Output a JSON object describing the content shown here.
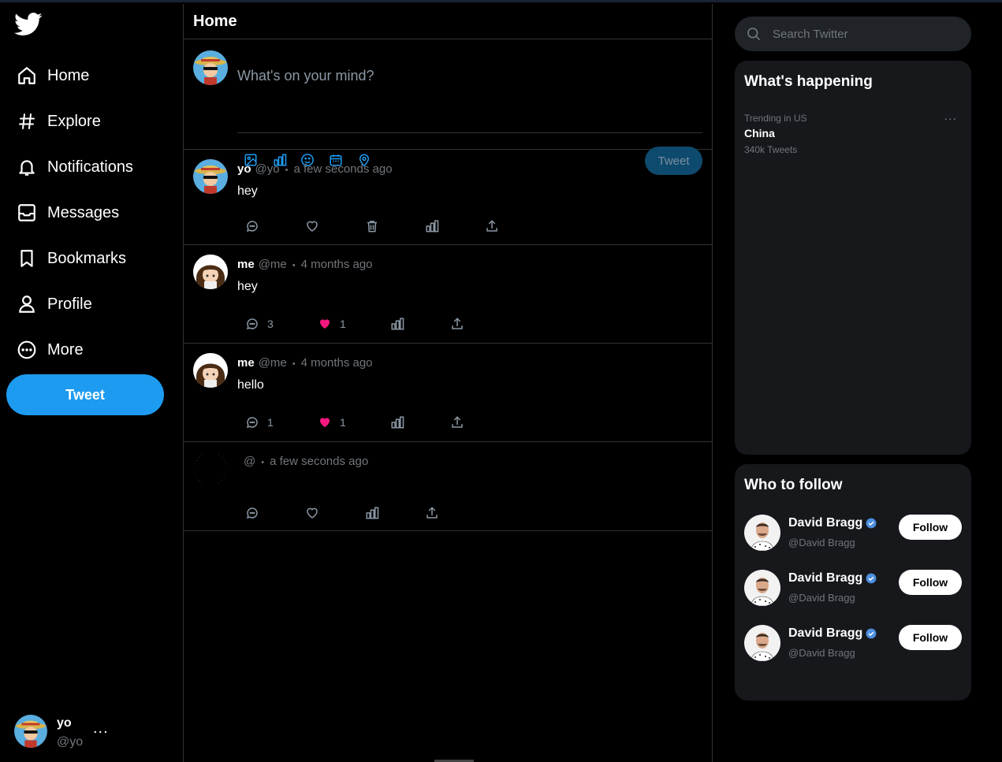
{
  "colors": {
    "accent": "#1d9bf0",
    "like": "#f91880",
    "background": "#000000",
    "panel": "#16181c",
    "muted": "#71767b"
  },
  "nav": {
    "logo_icon": "twitter-bird-icon",
    "items": [
      {
        "label": "Home",
        "icon": "home-icon"
      },
      {
        "label": "Explore",
        "icon": "hashtag-icon"
      },
      {
        "label": "Notifications",
        "icon": "bell-icon"
      },
      {
        "label": "Messages",
        "icon": "envelope-icon"
      },
      {
        "label": "Bookmarks",
        "icon": "bookmark-icon"
      },
      {
        "label": "Profile",
        "icon": "person-icon"
      },
      {
        "label": "More",
        "icon": "more-circle-icon"
      }
    ],
    "tweet_button": "Tweet"
  },
  "account": {
    "name": "yo",
    "handle": "@yo",
    "more": "..."
  },
  "main": {
    "title": "Home",
    "composer": {
      "placeholder": "What's on your mind?",
      "tools": [
        "image-icon",
        "poll-icon",
        "emoji-icon",
        "schedule-icon",
        "location-icon"
      ],
      "submit_label": "Tweet"
    },
    "tweets": [
      {
        "name": "yo",
        "handle": "@yo",
        "dot": "•",
        "time": "a few seconds ago",
        "text": "hey",
        "replies": "",
        "likes": "",
        "liked": false
      },
      {
        "name": "me",
        "handle": "@me",
        "dot": "•",
        "time": "4 months ago",
        "text": "hey",
        "replies": "3",
        "likes": "1",
        "liked": true
      },
      {
        "name": "me",
        "handle": "@me",
        "dot": "•",
        "time": "4 months ago",
        "text": "hello",
        "replies": "1",
        "likes": "1",
        "liked": true
      },
      {
        "name": "",
        "handle": "@",
        "dot": "•",
        "time": "a few seconds ago",
        "text": "",
        "replies": "",
        "likes": "",
        "liked": false
      }
    ]
  },
  "sidebar_right": {
    "search_placeholder": "Search Twitter",
    "trends": {
      "title": "What's happening",
      "items": [
        {
          "context": "Trending in US",
          "name": "China",
          "count": "340k Tweets",
          "more": "..."
        }
      ]
    },
    "who_to_follow": {
      "title": "Who to follow",
      "items": [
        {
          "name": "David Bragg",
          "handle": "@David Bragg",
          "verified": true,
          "button": "Follow"
        },
        {
          "name": "David Bragg",
          "handle": "@David Bragg",
          "verified": true,
          "button": "Follow"
        },
        {
          "name": "David Bragg",
          "handle": "@David Bragg",
          "verified": true,
          "button": "Follow"
        }
      ]
    }
  }
}
